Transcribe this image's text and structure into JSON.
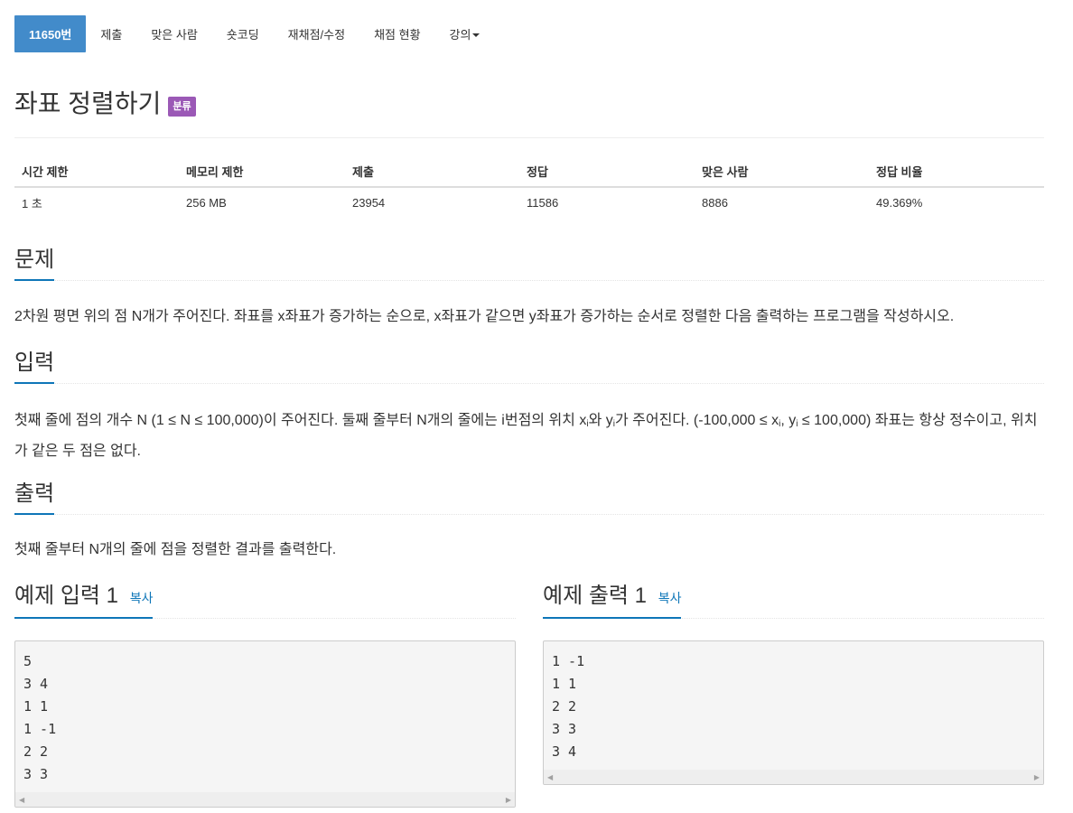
{
  "tabs": [
    {
      "label": "11650번"
    },
    {
      "label": "제출"
    },
    {
      "label": "맞은 사람"
    },
    {
      "label": "숏코딩"
    },
    {
      "label": "재채점/수정"
    },
    {
      "label": "채점 현황"
    },
    {
      "label": "강의"
    }
  ],
  "problem": {
    "title": "좌표 정렬하기",
    "badge": "분류"
  },
  "info": {
    "headers": [
      "시간 제한",
      "메모리 제한",
      "제출",
      "정답",
      "맞은 사람",
      "정답 비율"
    ],
    "values": [
      "1 초",
      "256 MB",
      "23954",
      "11586",
      "8886",
      "49.369%"
    ]
  },
  "sections": {
    "problem_heading": "문제",
    "problem_text": "2차원 평면 위의 점 N개가 주어진다. 좌표를 x좌표가 증가하는 순으로, x좌표가 같으면 y좌표가 증가하는 순서로 정렬한 다음 출력하는 프로그램을 작성하시오.",
    "input_heading": "입력",
    "input_text_a": "첫째 줄에 점의 개수 N (1 ≤ N ≤ 100,000)이 주어진다. 둘째 줄부터 N개의 줄에는 i번점의 위치 x",
    "input_sub_i": "i",
    "input_text_b": "와 y",
    "input_text_c": "가 주어진다. (-100,000 ≤ x",
    "input_text_d": ", y",
    "input_text_e": " ≤ 100,000) 좌표는 항상 정수이고, 위치가 같은 두 점은 없다.",
    "output_heading": "출력",
    "output_text": "첫째 줄부터 N개의 줄에 점을 정렬한 결과를 출력한다."
  },
  "samples": {
    "input_heading": "예제 입력 1",
    "output_heading": "예제 출력 1",
    "copy_label": "복사",
    "input": "5\n3 4\n1 1\n1 -1\n2 2\n3 3",
    "output": "1 -1\n1 1\n2 2\n3 3\n3 4"
  },
  "icons": {
    "scroll_left": "◀",
    "scroll_right": "▶"
  },
  "colors": {
    "tab_active": "#428bca",
    "badge": "#9b59b6",
    "accent": "#0e76b8"
  }
}
